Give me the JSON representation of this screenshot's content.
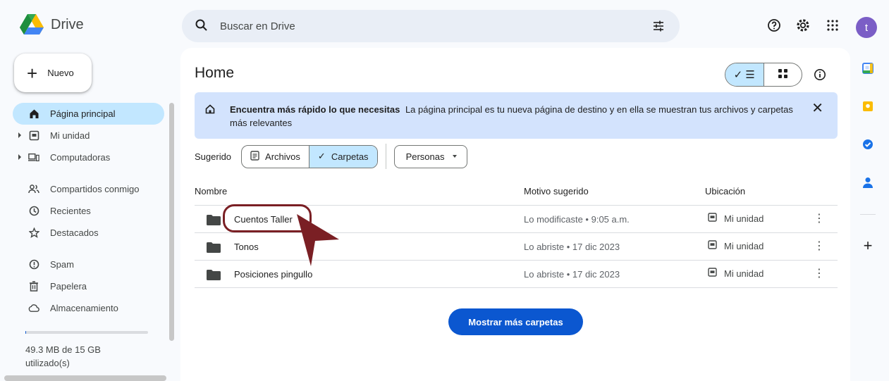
{
  "app": {
    "name": "Drive"
  },
  "search": {
    "placeholder": "Buscar en Drive"
  },
  "user": {
    "initial": "t",
    "color": "#7b5ec6"
  },
  "new_button": {
    "label": "Nuevo"
  },
  "sidebar": {
    "items": [
      {
        "label": "Página principal",
        "icon": "home-icon",
        "active": true
      },
      {
        "label": "Mi unidad",
        "icon": "my-drive-icon",
        "expandable": true
      },
      {
        "label": "Computadoras",
        "icon": "computers-icon",
        "expandable": true
      },
      {
        "label": "Compartidos conmigo",
        "icon": "shared-icon"
      },
      {
        "label": "Recientes",
        "icon": "clock-icon"
      },
      {
        "label": "Destacados",
        "icon": "star-icon"
      },
      {
        "label": "Spam",
        "icon": "spam-icon"
      },
      {
        "label": "Papelera",
        "icon": "trash-icon"
      },
      {
        "label": "Almacenamiento",
        "icon": "cloud-icon"
      }
    ],
    "storage_text": "49.3 MB de 15 GB utilizado(s)",
    "storage_fraction": 0.003
  },
  "main": {
    "title": "Home",
    "banner": {
      "bold": "Encuentra más rápido lo que necesitas",
      "text": "La página principal es tu nueva página de destino y en ella se muestran tus archivos y carpetas más relevantes"
    },
    "filters": {
      "label": "Sugerido",
      "files": "Archivos",
      "folders": "Carpetas",
      "people": "Personas"
    },
    "columns": {
      "name": "Nombre",
      "reason": "Motivo sugerido",
      "location": "Ubicación"
    },
    "rows": [
      {
        "name": "Cuentos Taller",
        "reason": "Lo modificaste • 9:05 a.m.",
        "location": "Mi unidad"
      },
      {
        "name": "Tonos",
        "reason": "Lo abriste • 17 dic 2023",
        "location": "Mi unidad"
      },
      {
        "name": "Posiciones pingullo",
        "reason": "Lo abriste • 17 dic 2023",
        "location": "Mi unidad"
      }
    ],
    "show_more": "Mostrar más carpetas"
  },
  "colors": {
    "accent": "#0b57d0",
    "selected": "#c2e7ff",
    "banner": "#d3e3fd",
    "annotation": "#7a1f24"
  }
}
